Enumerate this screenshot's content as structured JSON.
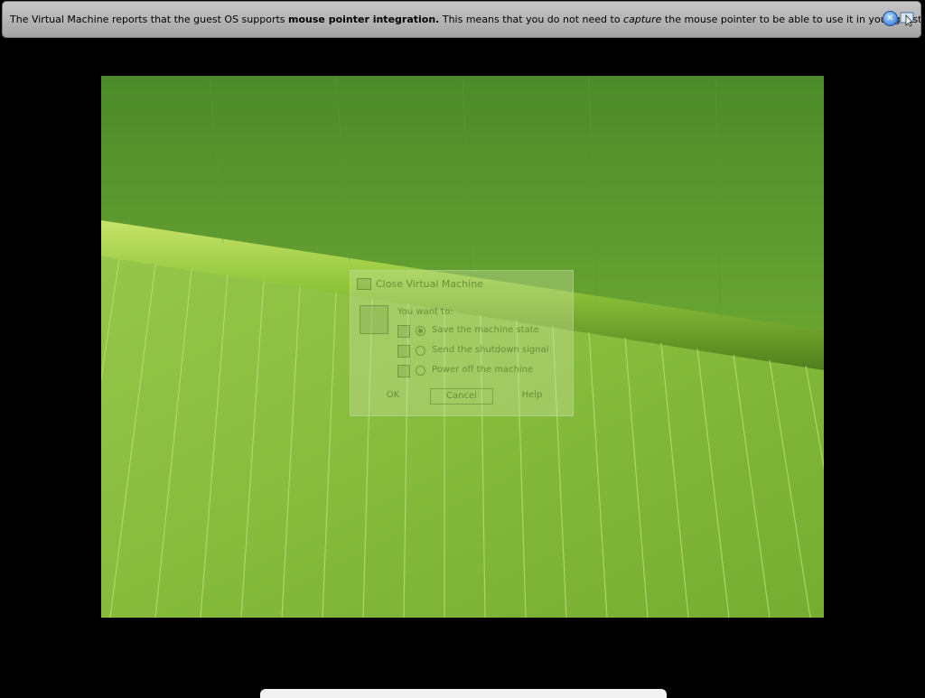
{
  "notification": {
    "text_before": "The Virtual Machine reports that the guest OS supports ",
    "bold_text": "mouse pointer integration.",
    "text_middle": " This means that you do not need to ",
    "italic_text": "capture",
    "text_after": " the mouse pointer to be able to use it in your guest OS -- all mouse",
    "close_icon": "close-icon",
    "mouse_integration_icon": "mouse-pointer-integration-icon"
  },
  "dialog": {
    "title": "Close Virtual Machine",
    "prompt": "You want to:",
    "options": [
      {
        "label": "Save the machine state",
        "selected": true
      },
      {
        "label": "Send the shutdown signal",
        "selected": false
      },
      {
        "label": "Power off the machine",
        "selected": false
      }
    ],
    "buttons": {
      "ok": "OK",
      "cancel": "Cancel",
      "help": "Help"
    }
  },
  "colors": {
    "background": "#000000",
    "notification_bar": "#b4b4b4",
    "leaf_green": "#7ab63a"
  }
}
